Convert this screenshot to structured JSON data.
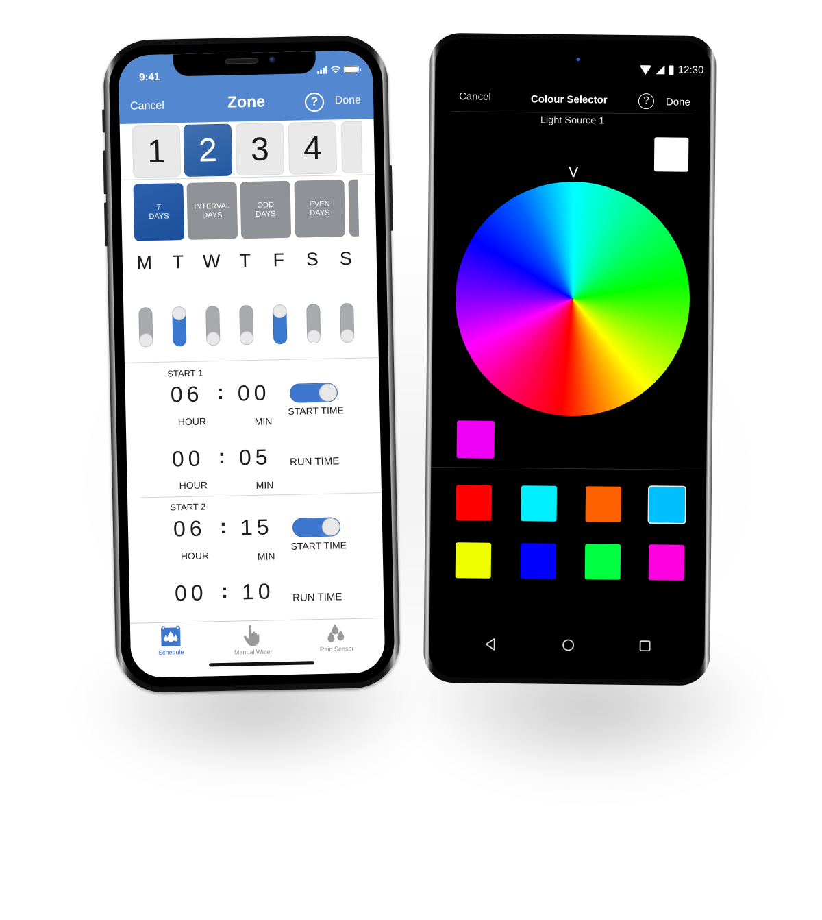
{
  "left_phone": {
    "status_bar": {
      "time": "9:41"
    },
    "header": {
      "cancel_label": "Cancel",
      "title": "Zone",
      "help_icon_label": "?",
      "done_label": "Done"
    },
    "zones": [
      {
        "label": "1",
        "selected": false
      },
      {
        "label": "2",
        "selected": true
      },
      {
        "label": "3",
        "selected": false
      },
      {
        "label": "4",
        "selected": false
      }
    ],
    "schedule_modes": [
      {
        "line1": "7",
        "line2": "DAYS",
        "selected": true
      },
      {
        "line1": "INTERVAL",
        "line2": "DAYS",
        "selected": false
      },
      {
        "line1": "ODD",
        "line2": "DAYS",
        "selected": false
      },
      {
        "line1": "EVEN",
        "line2": "DAYS",
        "selected": false
      }
    ],
    "days": [
      {
        "letter": "M",
        "enabled": false
      },
      {
        "letter": "T",
        "enabled": true
      },
      {
        "letter": "W",
        "enabled": false
      },
      {
        "letter": "T",
        "enabled": false
      },
      {
        "letter": "F",
        "enabled": true
      },
      {
        "letter": "S",
        "enabled": false
      },
      {
        "letter": "S",
        "enabled": false
      }
    ],
    "starts": [
      {
        "label": "START 1",
        "start_hour": "06",
        "start_min": "00",
        "start_time_enabled": true,
        "start_time_label": "START TIME",
        "run_hour": "00",
        "run_min": "05",
        "run_time_label": "RUN TIME",
        "hour_label": "HOUR",
        "min_label": "MIN",
        "colon": ":"
      },
      {
        "label": "START 2",
        "start_hour": "06",
        "start_min": "15",
        "start_time_enabled": true,
        "start_time_label": "START TIME",
        "run_hour": "00",
        "run_min": "10",
        "run_time_label": "RUN TIME",
        "hour_label": "HOUR",
        "min_label": "MIN",
        "colon": ":"
      }
    ],
    "tabbar": [
      {
        "label": "Schedule",
        "icon": "water-drops-calendar-icon",
        "active": true
      },
      {
        "label": "Manual Water",
        "icon": "pointing-hand-icon",
        "active": false
      },
      {
        "label": "Rain Sensor",
        "icon": "rain-drops-icon",
        "active": false
      }
    ],
    "colors": {
      "header": "#5387d0",
      "accent": "#3b78cf",
      "selected_tile": "#2459a2",
      "inactive_tile": "#8f9296"
    }
  },
  "right_phone": {
    "status_bar": {
      "time": "12:30"
    },
    "header": {
      "cancel_label": "Cancel",
      "title": "Colour Selector",
      "help_icon_label": "?",
      "done_label": "Done"
    },
    "subtitle": "Light Source 1",
    "wheel_marker": "V",
    "preview_color": "#ffffff",
    "current_color": "#f000f4",
    "swatches": [
      {
        "color": "#ff0000",
        "selected": false
      },
      {
        "color": "#00f0ff",
        "selected": false
      },
      {
        "color": "#ff6000",
        "selected": false
      },
      {
        "color": "#00bfff",
        "selected": true
      },
      {
        "color": "#f0ff00",
        "selected": false
      },
      {
        "color": "#0000ff",
        "selected": false
      },
      {
        "color": "#00ff40",
        "selected": false
      },
      {
        "color": "#ff00e0",
        "selected": false
      }
    ],
    "nav": [
      {
        "name": "back",
        "icon": "back-triangle-icon"
      },
      {
        "name": "home",
        "icon": "home-circle-icon"
      },
      {
        "name": "recents",
        "icon": "recents-square-icon"
      }
    ]
  }
}
